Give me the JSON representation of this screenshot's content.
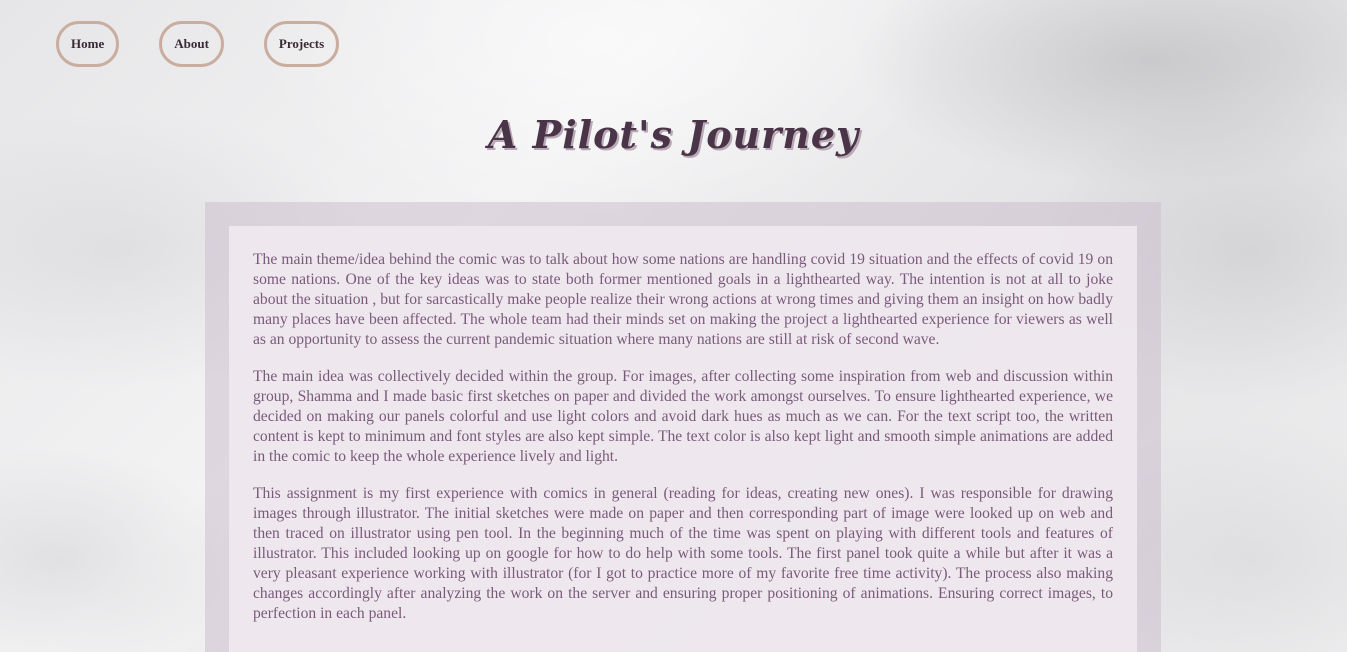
{
  "nav": {
    "items": [
      {
        "label": "Home"
      },
      {
        "label": "About"
      },
      {
        "label": "Projects"
      }
    ]
  },
  "page": {
    "title": "A Pilot's Journey"
  },
  "article": {
    "paragraphs": [
      "The main theme/idea behind the comic was to talk about how some nations are handling covid 19 situation and the effects of covid 19 on some nations. One of the key ideas was to state both former mentioned goals in a lighthearted way. The intention is not at all to joke about the situation , but for sarcastically make people realize their wrong actions at wrong times and giving them an insight on how badly many places have been affected. The whole team had their minds set on making the project a lighthearted experience for viewers as well as an opportunity to assess the current pandemic situation where many nations are still at risk of second wave.",
      "The main idea was collectively decided within the group. For images, after collecting some inspiration from web and discussion within group, Shamma and I made basic first sketches on paper and divided the work amongst ourselves. To ensure lighthearted experience, we decided on making our panels colorful and use light colors and avoid dark hues as much as we can. For the text script too, the written content is kept to minimum and font styles are also kept simple. The text color is also kept light and smooth simple animations are added in the comic to keep the whole experience lively and light.",
      "This assignment is my first experience with comics in general (reading for ideas, creating new ones). I was responsible for drawing images through illustrator. The initial sketches were made on paper and then corresponding part of image were looked up on web and then traced on illustrator using pen tool. In the beginning much of the time was spent on playing with different tools and features of illustrator. This included looking up on google for how to do help with some tools. The first panel took quite a while but after it was a very pleasant experience working with illustrator (for I got to practice more of my favorite free time activity). The process also making changes accordingly after analyzing the work on the server and ensuring proper positioning of animations. Ensuring correct images, to perfection in each panel."
    ]
  }
}
